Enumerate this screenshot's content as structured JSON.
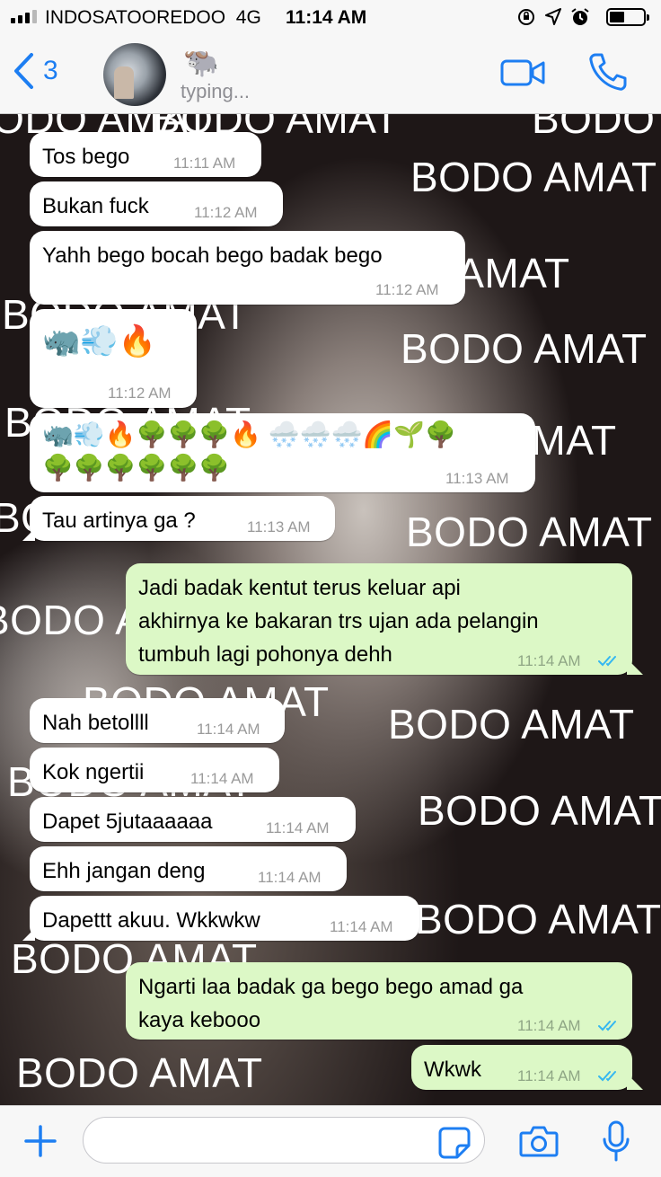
{
  "status_bar": {
    "carrier": "INDOSATOOREDOO",
    "network": "4G",
    "time": "11:14 AM"
  },
  "header": {
    "back_count": "3",
    "contact_name": "🐃",
    "status": "typing...",
    "accent_color": "#1d7ef2"
  },
  "wallpaper": {
    "watermark_text": "BODO AMAT"
  },
  "messages": [
    {
      "direction": "in",
      "text": "Tos bego",
      "time": "11:11 AM"
    },
    {
      "direction": "in",
      "text": "Bukan fuck",
      "time": "11:12 AM"
    },
    {
      "direction": "in",
      "text": "Yahh bego bocah bego badak bego",
      "time": "11:12 AM"
    },
    {
      "direction": "in",
      "text": "🦏💨🔥",
      "time": "11:12 AM"
    },
    {
      "direction": "in",
      "text": "🦏💨🔥🌳🌳🌳🔥 🌨️🌨️🌨️🌈🌱🌳\n🌳🌳🌳🌳🌳🌳",
      "time": "11:13 AM"
    },
    {
      "direction": "in",
      "text": "Tau artinya ga ?",
      "time": "11:13 AM"
    },
    {
      "direction": "out",
      "text": "Jadi badak kentut terus keluar api\nakhirnya ke bakaran trs ujan ada pelangin\ntumbuh lagi pohonya dehh",
      "time": "11:14 AM",
      "status": "read"
    },
    {
      "direction": "in",
      "text": "Nah betollll",
      "time": "11:14 AM"
    },
    {
      "direction": "in",
      "text": "Kok ngertii",
      "time": "11:14 AM"
    },
    {
      "direction": "in",
      "text": "Dapet 5jutaaaaaa",
      "time": "11:14 AM"
    },
    {
      "direction": "in",
      "text": "Ehh jangan deng",
      "time": "11:14 AM"
    },
    {
      "direction": "in",
      "text": "Dapettt akuu. Wkkwkw",
      "time": "11:14 AM"
    },
    {
      "direction": "out",
      "text": "Ngarti laa badak ga bego bego amad ga\nkaya kebooo",
      "time": "11:14 AM",
      "status": "read"
    },
    {
      "direction": "out",
      "text": "Wkwk",
      "time": "11:14 AM",
      "status": "read"
    }
  ],
  "composer": {
    "placeholder": ""
  },
  "colors": {
    "outgoing_bubble": "#dcf8c6",
    "incoming_bubble": "#ffffff",
    "read_ticks": "#34b7f1"
  }
}
